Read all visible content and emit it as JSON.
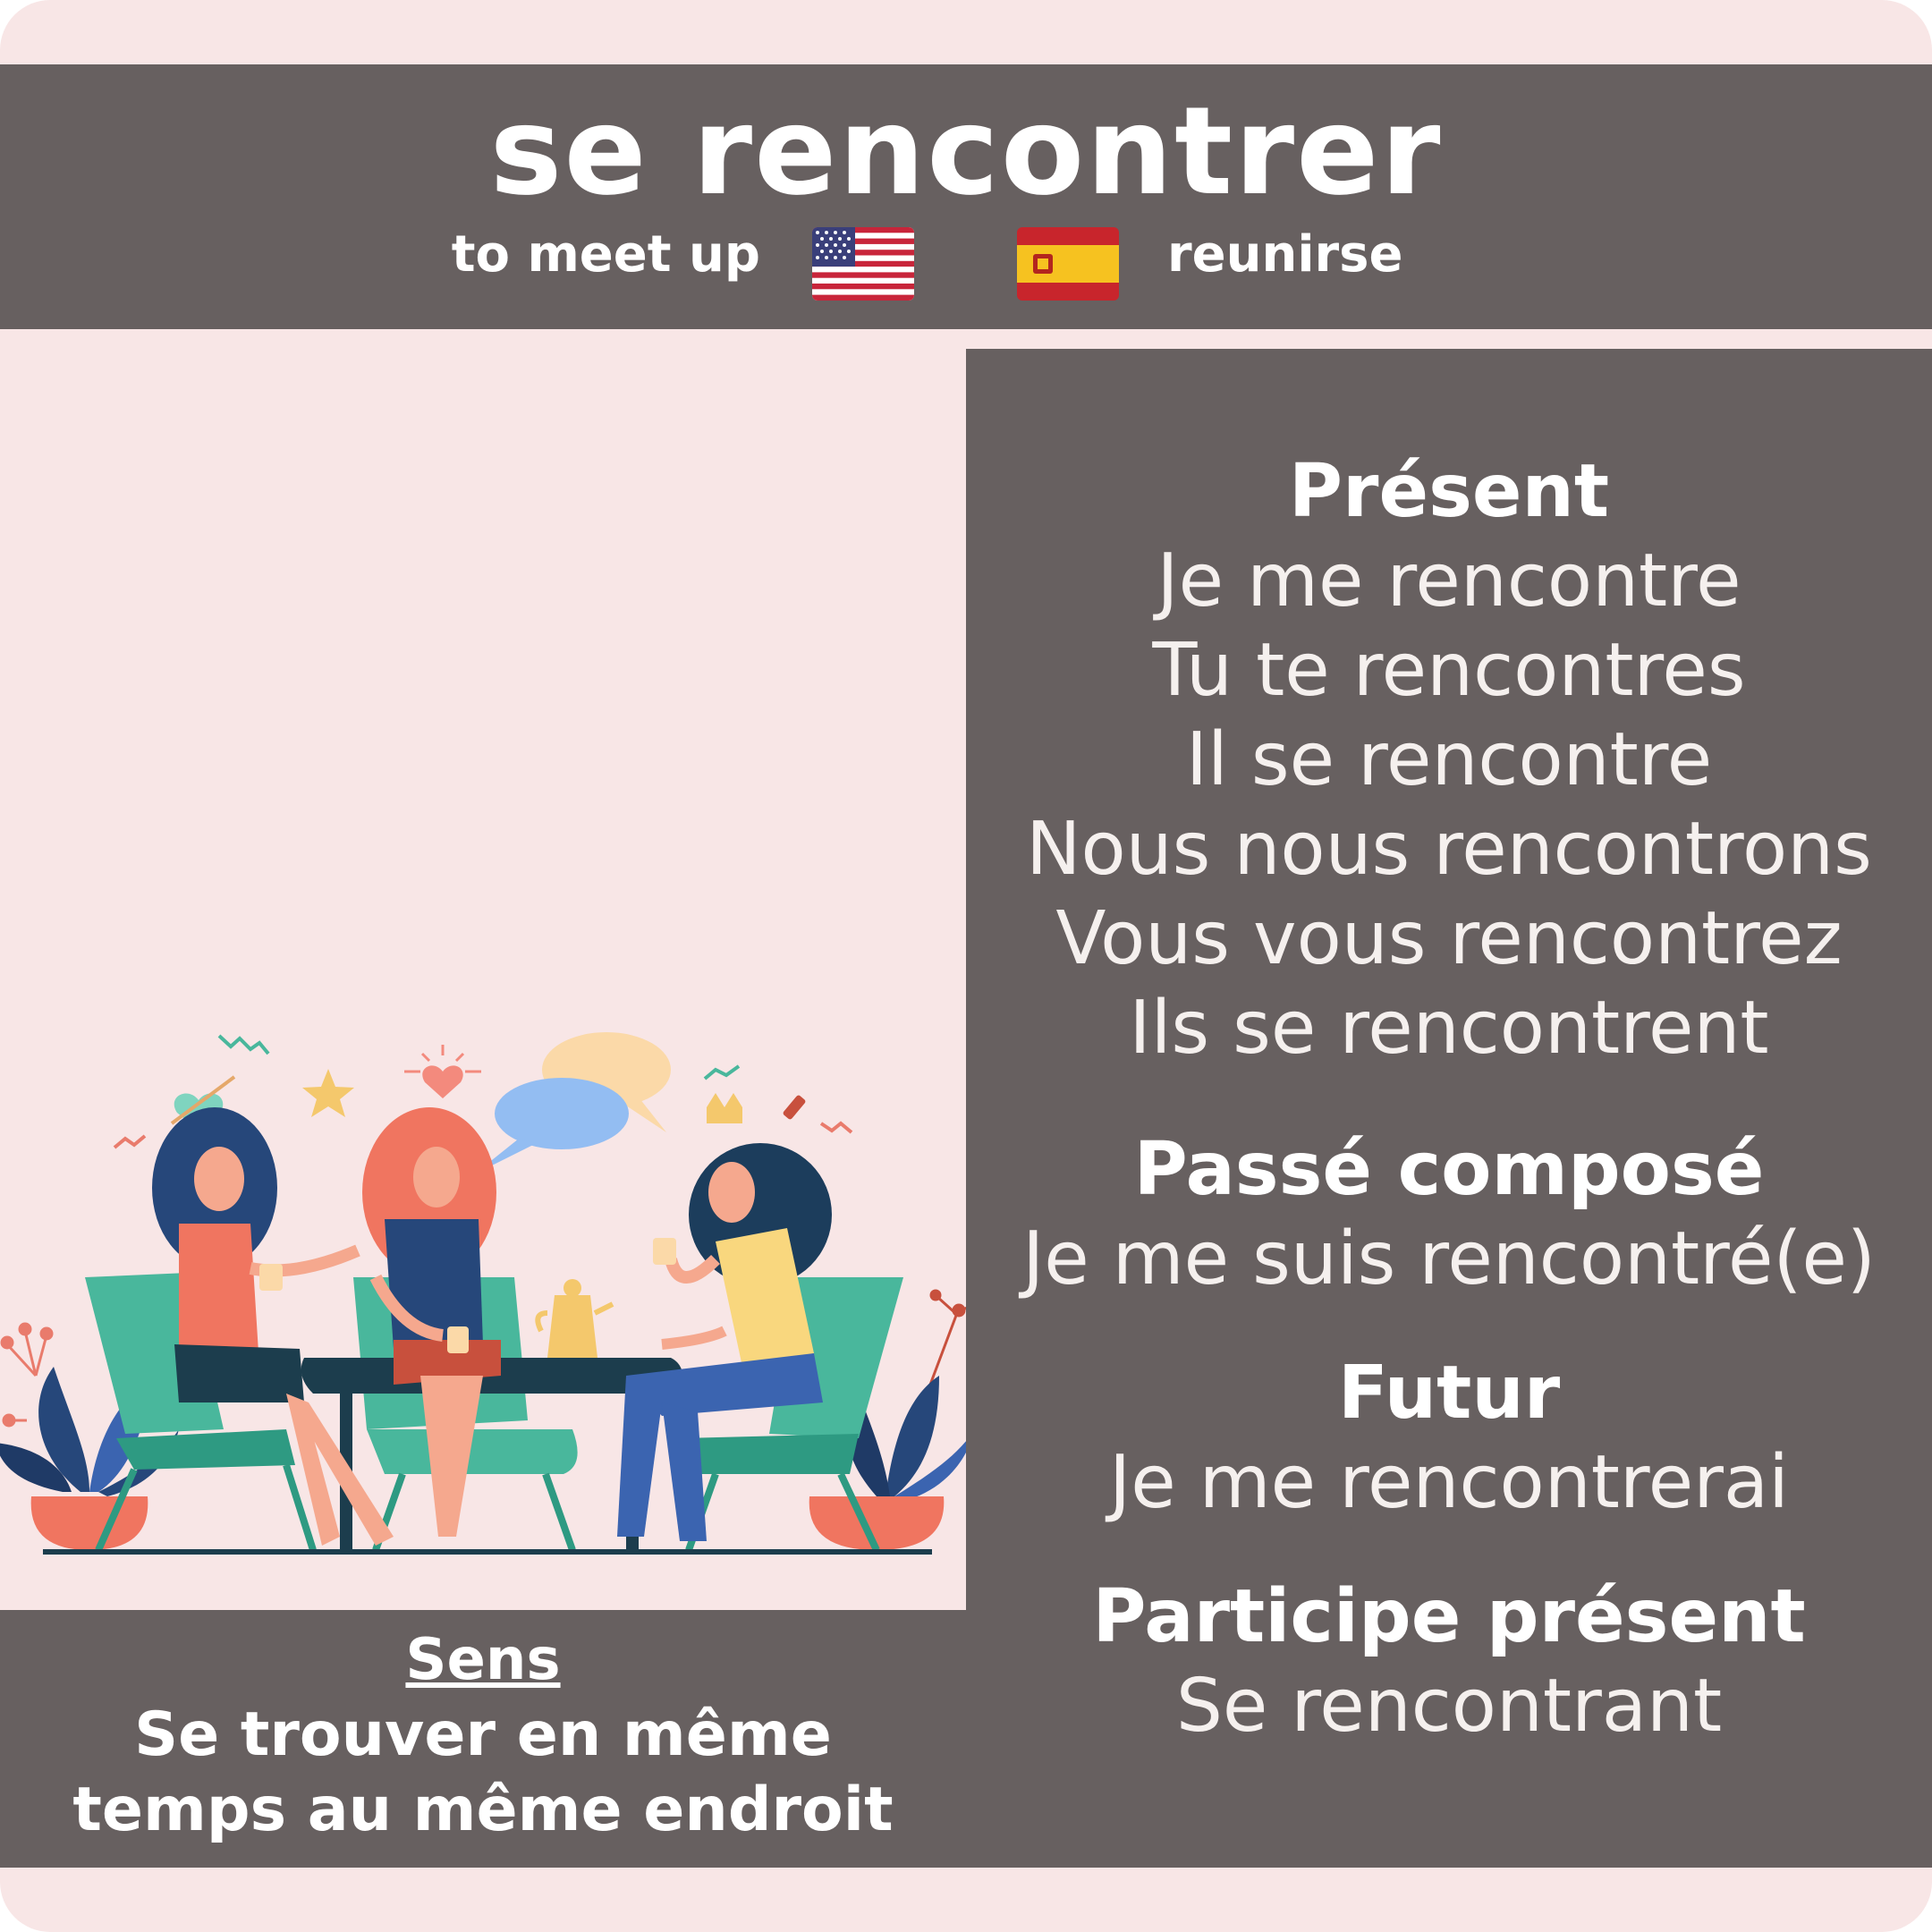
{
  "header": {
    "title": "se rencontrer",
    "english": "to meet up",
    "spanish": "reunirse",
    "flag_english_icon": "us-flag-icon",
    "flag_spanish_icon": "spain-flag-icon"
  },
  "illustration": {
    "icon": "friends-meeting-at-table-illustration"
  },
  "conjugation": {
    "present": {
      "title": "Présent",
      "lines": [
        "Je me rencontre",
        "Tu te rencontres",
        "Il se rencontre",
        "Nous nous rencontrons",
        "Vous vous rencontrez",
        "Ils se rencontrent"
      ]
    },
    "passe_compose": {
      "title": "Passé composé",
      "line": "Je me suis rencontré(e)"
    },
    "futur": {
      "title": "Futur",
      "line": "Je me rencontrerai"
    },
    "participe_present": {
      "title": "Participe présent",
      "line": "Se rencontrant"
    }
  },
  "sens": {
    "label": "Sens",
    "line1": "Se trouver en même",
    "line2": "temps au même endroit"
  },
  "colors": {
    "background": "#f8e6e6",
    "panel": "#676060",
    "text": "#ffffff"
  }
}
